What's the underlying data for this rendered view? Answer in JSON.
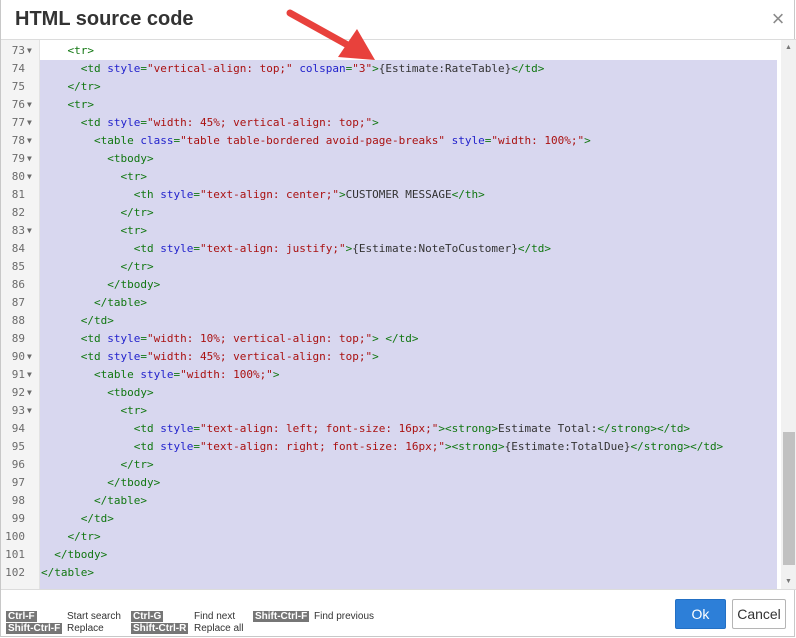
{
  "dialog": {
    "title": "HTML source code",
    "close_glyph": "×",
    "close_icon": "close-icon"
  },
  "editor": {
    "lines": [
      {
        "n": "73",
        "fold": true,
        "code": [
          [
            "t",
            "    <tr>"
          ]
        ]
      },
      {
        "n": "74",
        "fold": false,
        "code": [
          [
            "t",
            "      <td "
          ],
          [
            "a",
            "style"
          ],
          [
            "t",
            "="
          ],
          [
            "s",
            "\"vertical-align: top;\""
          ],
          [
            "t",
            " "
          ],
          [
            "a",
            "colspan"
          ],
          [
            "t",
            "="
          ],
          [
            "s",
            "\"3\""
          ],
          [
            "t",
            ">"
          ],
          [
            "p",
            "{Estimate:RateTable}"
          ],
          [
            "t",
            "</td>"
          ]
        ]
      },
      {
        "n": "75",
        "fold": false,
        "code": [
          [
            "t",
            "    </tr>"
          ]
        ]
      },
      {
        "n": "76",
        "fold": true,
        "code": [
          [
            "t",
            "    <tr>"
          ]
        ]
      },
      {
        "n": "77",
        "fold": true,
        "code": [
          [
            "t",
            "      <td "
          ],
          [
            "a",
            "style"
          ],
          [
            "t",
            "="
          ],
          [
            "s",
            "\"width: 45%; vertical-align: top;\""
          ],
          [
            "t",
            ">"
          ]
        ]
      },
      {
        "n": "78",
        "fold": true,
        "code": [
          [
            "t",
            "        <table "
          ],
          [
            "a",
            "class"
          ],
          [
            "t",
            "="
          ],
          [
            "s",
            "\"table table-bordered avoid-page-breaks\""
          ],
          [
            "t",
            " "
          ],
          [
            "a",
            "style"
          ],
          [
            "t",
            "="
          ],
          [
            "s",
            "\"width: 100%;\""
          ],
          [
            "t",
            ">"
          ]
        ]
      },
      {
        "n": "79",
        "fold": true,
        "code": [
          [
            "t",
            "          <tbody>"
          ]
        ]
      },
      {
        "n": "80",
        "fold": true,
        "code": [
          [
            "t",
            "            <tr>"
          ]
        ]
      },
      {
        "n": "81",
        "fold": false,
        "code": [
          [
            "t",
            "              <th "
          ],
          [
            "a",
            "style"
          ],
          [
            "t",
            "="
          ],
          [
            "s",
            "\"text-align: center;\""
          ],
          [
            "t",
            ">"
          ],
          [
            "p",
            "CUSTOMER MESSAGE"
          ],
          [
            "t",
            "</th>"
          ]
        ]
      },
      {
        "n": "82",
        "fold": false,
        "code": [
          [
            "t",
            "            </tr>"
          ]
        ]
      },
      {
        "n": "83",
        "fold": true,
        "code": [
          [
            "t",
            "            <tr>"
          ]
        ]
      },
      {
        "n": "84",
        "fold": false,
        "code": [
          [
            "t",
            "              <td "
          ],
          [
            "a",
            "style"
          ],
          [
            "t",
            "="
          ],
          [
            "s",
            "\"text-align: justify;\""
          ],
          [
            "t",
            ">"
          ],
          [
            "p",
            "{Estimate:NoteToCustomer}"
          ],
          [
            "t",
            "</td>"
          ]
        ]
      },
      {
        "n": "85",
        "fold": false,
        "code": [
          [
            "t",
            "            </tr>"
          ]
        ]
      },
      {
        "n": "86",
        "fold": false,
        "code": [
          [
            "t",
            "          </tbody>"
          ]
        ]
      },
      {
        "n": "87",
        "fold": false,
        "code": [
          [
            "t",
            "        </table>"
          ]
        ]
      },
      {
        "n": "88",
        "fold": false,
        "code": [
          [
            "t",
            "      </td>"
          ]
        ]
      },
      {
        "n": "89",
        "fold": false,
        "code": [
          [
            "t",
            "      <td "
          ],
          [
            "a",
            "style"
          ],
          [
            "t",
            "="
          ],
          [
            "s",
            "\"width: 10%; vertical-align: top;\""
          ],
          [
            "t",
            "> </td>"
          ]
        ]
      },
      {
        "n": "90",
        "fold": true,
        "code": [
          [
            "t",
            "      <td "
          ],
          [
            "a",
            "style"
          ],
          [
            "t",
            "="
          ],
          [
            "s",
            "\"width: 45%; vertical-align: top;\""
          ],
          [
            "t",
            ">"
          ]
        ]
      },
      {
        "n": "91",
        "fold": true,
        "code": [
          [
            "t",
            "        <table "
          ],
          [
            "a",
            "style"
          ],
          [
            "t",
            "="
          ],
          [
            "s",
            "\"width: 100%;\""
          ],
          [
            "t",
            ">"
          ]
        ]
      },
      {
        "n": "92",
        "fold": true,
        "code": [
          [
            "t",
            "          <tbody>"
          ]
        ]
      },
      {
        "n": "93",
        "fold": true,
        "code": [
          [
            "t",
            "            <tr>"
          ]
        ]
      },
      {
        "n": "94",
        "fold": false,
        "code": [
          [
            "t",
            "              <td "
          ],
          [
            "a",
            "style"
          ],
          [
            "t",
            "="
          ],
          [
            "s",
            "\"text-align: left; font-size: 16px;\""
          ],
          [
            "t",
            ">"
          ],
          [
            "t",
            "<strong>"
          ],
          [
            "p",
            "Estimate Total:"
          ],
          [
            "t",
            "</strong></td>"
          ]
        ]
      },
      {
        "n": "95",
        "fold": false,
        "code": [
          [
            "t",
            "              <td "
          ],
          [
            "a",
            "style"
          ],
          [
            "t",
            "="
          ],
          [
            "s",
            "\"text-align: right; font-size: 16px;\""
          ],
          [
            "t",
            ">"
          ],
          [
            "t",
            "<strong>"
          ],
          [
            "p",
            "{Estimate:TotalDue}"
          ],
          [
            "t",
            "</strong></td>"
          ]
        ]
      },
      {
        "n": "96",
        "fold": false,
        "code": [
          [
            "t",
            "            </tr>"
          ]
        ]
      },
      {
        "n": "97",
        "fold": false,
        "code": [
          [
            "t",
            "          </tbody>"
          ]
        ]
      },
      {
        "n": "98",
        "fold": false,
        "code": [
          [
            "t",
            "        </table>"
          ]
        ]
      },
      {
        "n": "99",
        "fold": false,
        "code": [
          [
            "t",
            "      </td>"
          ]
        ]
      },
      {
        "n": "100",
        "fold": false,
        "code": [
          [
            "t",
            "    </tr>"
          ]
        ]
      },
      {
        "n": "101",
        "fold": false,
        "code": [
          [
            "t",
            "  </tbody>"
          ]
        ]
      },
      {
        "n": "102",
        "fold": false,
        "code": [
          [
            "t",
            "</table>"
          ]
        ]
      }
    ],
    "colors": {
      "tag": "#117711",
      "attr": "#2222cc",
      "string": "#aa1111",
      "text": "#333333",
      "selection": "#d8d7ef"
    }
  },
  "annotation": {
    "color": "#e8413c",
    "icon": "red-arrow-icon"
  },
  "shortcuts": {
    "start_search_key": "Ctrl-F",
    "start_search": "Start search",
    "replace_key": "Shift-Ctrl-F",
    "replace": "Replace",
    "find_next_key": "Ctrl-G",
    "find_next": "Find next",
    "replace_all_key": "Shift-Ctrl-R",
    "replace_all": "Replace all",
    "find_previous_key": "Shift-Ctrl-F",
    "find_previous": "Find previous"
  },
  "buttons": {
    "ok": "Ok",
    "cancel": "Cancel",
    "ok_color": "#2d7fd8"
  }
}
